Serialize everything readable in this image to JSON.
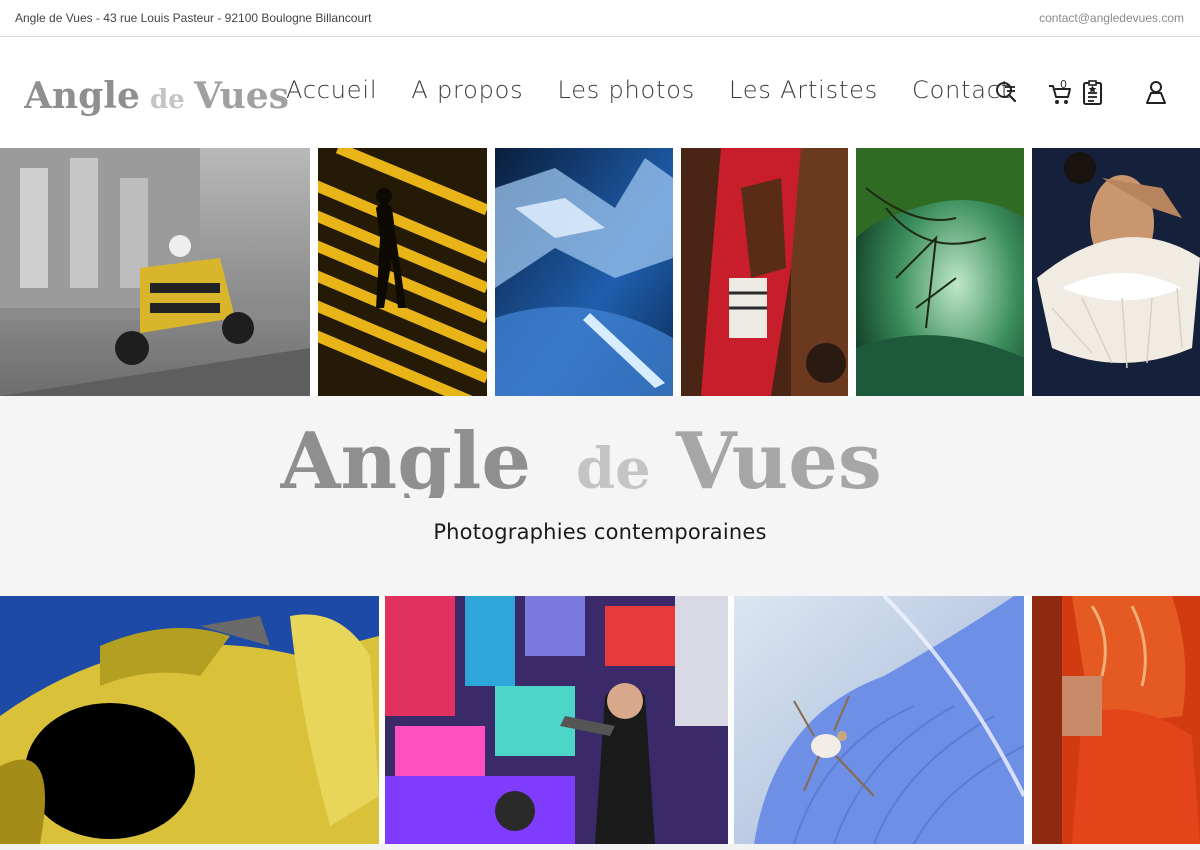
{
  "topbar": {
    "address": "Angle de Vues - 43 rue Louis Pasteur - 92100 Boulogne Billancourt",
    "email": "contact@angledevues.com"
  },
  "logo": {
    "text_angle": "Angle",
    "text_de": "de",
    "text_vues": "Vues"
  },
  "nav": {
    "items": [
      {
        "label": "Accueil"
      },
      {
        "label": "A propos"
      },
      {
        "label": "Les photos"
      },
      {
        "label": "Les Artistes"
      },
      {
        "label": "Contact"
      }
    ]
  },
  "header_icons": {
    "search": "search-icon",
    "cart": "cart-icon",
    "cart_count": "0",
    "wishlist": "wishlist-clipboard-icon",
    "account": "user-icon"
  },
  "band": {
    "tagline": "Photographies contemporaines"
  },
  "gallery_top": [
    {
      "name": "race-car-photo"
    },
    {
      "name": "silhouette-stairs-photo"
    },
    {
      "name": "ice-water-photo"
    },
    {
      "name": "red-sari-woman-photo"
    },
    {
      "name": "green-river-photo"
    },
    {
      "name": "ballerina-photo"
    }
  ],
  "gallery_bottom": [
    {
      "name": "yellow-car-photo"
    },
    {
      "name": "pop-art-times-square-photo"
    },
    {
      "name": "spider-on-blue-photo"
    },
    {
      "name": "orange-dress-photo"
    }
  ],
  "colors": {
    "logo_dark": "#8f8f8f",
    "logo_mid": "#a6a6a6",
    "logo_light": "#c4c4c4",
    "band_bg": "#f5f5f5"
  }
}
